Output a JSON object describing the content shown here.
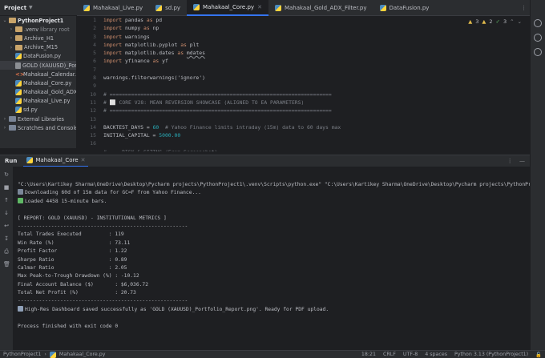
{
  "project_panel": {
    "title": "Project",
    "tree": [
      {
        "label": "PythonProject1",
        "type": "folder",
        "depth": 0,
        "expanded": true,
        "bold": true
      },
      {
        "label": ".venv",
        "suffix": "library root",
        "type": "folder",
        "depth": 1,
        "expanded": false
      },
      {
        "label": "Archive_H1",
        "type": "folder",
        "depth": 1,
        "expanded": false
      },
      {
        "label": "Archive_M15",
        "type": "folder",
        "depth": 1,
        "expanded": false
      },
      {
        "label": "DataFusion.py",
        "type": "py",
        "depth": 1
      },
      {
        "label": "GOLD (XAUUSD)_Port",
        "type": "file",
        "depth": 1,
        "selected": true
      },
      {
        "label": "Mahakaal_Calendar.h",
        "type": "html",
        "depth": 1
      },
      {
        "label": "Mahakaal_Core.py",
        "type": "py",
        "depth": 1
      },
      {
        "label": "Mahakaal_Gold_ADX_",
        "type": "py",
        "depth": 1
      },
      {
        "label": "Mahakaal_Live.py",
        "type": "py",
        "depth": 1
      },
      {
        "label": "sd.py",
        "type": "py",
        "depth": 1
      },
      {
        "label": "External Libraries",
        "type": "lib",
        "depth": 0,
        "expanded": false
      },
      {
        "label": "Scratches and Consoles",
        "type": "scratch",
        "depth": 0,
        "expanded": false
      }
    ]
  },
  "tabs": [
    {
      "label": "Mahakaal_Live.py",
      "active": false
    },
    {
      "label": "sd.py",
      "active": false
    },
    {
      "label": "Mahakaal_Core.py",
      "active": true
    },
    {
      "label": "Mahakaal_Gold_ADX_Filter.py",
      "active": false
    },
    {
      "label": "DataFusion.py",
      "active": false
    }
  ],
  "inspections": {
    "warnings": "3",
    "weak": "2",
    "typos": "3"
  },
  "editor": {
    "line_numbers": [
      "1",
      "2",
      "3",
      "4",
      "5",
      "6",
      "7",
      "8",
      "9",
      "10",
      "11",
      "12",
      "13",
      "14",
      "15",
      "16"
    ],
    "lines": [
      [
        {
          "t": "import",
          "c": "kw"
        },
        {
          "t": " pandas "
        },
        {
          "t": "as",
          "c": "kw"
        },
        {
          "t": " pd"
        }
      ],
      [
        {
          "t": "import",
          "c": "kw"
        },
        {
          "t": " numpy "
        },
        {
          "t": "as",
          "c": "kw"
        },
        {
          "t": " np"
        }
      ],
      [
        {
          "t": "import",
          "c": "kw"
        },
        {
          "t": " warnings"
        }
      ],
      [
        {
          "t": "import",
          "c": "kw"
        },
        {
          "t": " matplotlib.pyplot "
        },
        {
          "t": "as",
          "c": "kw"
        },
        {
          "t": " plt"
        }
      ],
      [
        {
          "t": "import",
          "c": "kw"
        },
        {
          "t": " matplotlib.dates "
        },
        {
          "t": "as",
          "c": "kw"
        },
        {
          "t": " "
        },
        {
          "t": "mdates",
          "c": "uline"
        }
      ],
      [
        {
          "t": "import",
          "c": "kw"
        },
        {
          "t": " yfinance "
        },
        {
          "t": "as",
          "c": "kw"
        },
        {
          "t": " yf"
        }
      ],
      [],
      [
        {
          "t": "warnings.filterwarnings('ignore')"
        }
      ],
      [],
      [
        {
          "t": "# ========================================================================",
          "c": "cm"
        }
      ],
      [
        {
          "t": "# ⬜ CORE V28: MEAN REVERSION SHOWCASE (ALIGNED TO EA PARAMETERS)",
          "c": "cm"
        }
      ],
      [
        {
          "t": "# ========================================================================",
          "c": "cm"
        }
      ],
      [],
      [
        {
          "t": "BACKTEST_DAYS = "
        },
        {
          "t": "60",
          "c": "num"
        },
        {
          "t": "  # Yahoo Finance limits intraday (15m) data to 60 days max",
          "c": "cm"
        }
      ],
      [
        {
          "t": "INITIAL_CAPITAL = "
        },
        {
          "t": "5000.00",
          "c": "num"
        }
      ],
      [],
      [
        {
          "t": "# --- RISK & SIZING (From Screenshot) ---",
          "c": "cm"
        }
      ]
    ]
  },
  "run_panel": {
    "title": "Run",
    "tab_label": "Mahakaal_Core",
    "output": [
      {
        "text": "\"C:\\Users\\Kartikey Sharma\\OneDrive\\Desktop\\Pycharm projects\\PythonProject1\\.venv\\Scripts\\python.exe\" \"C:\\Users\\Kartikey Sharma\\OneDrive\\Desktop\\Pycharm projects\\PythonProj"
      },
      {
        "icon": "download-icon",
        "text": "Downloading 60d of 15m data for GC=F from Yahoo Finance..."
      },
      {
        "icon": "check-icon",
        "text": "Loaded 4458 15-minute bars."
      },
      {
        "text": ""
      },
      {
        "text": "[ REPORT: GOLD (XAUUSD) - INSTITUTIONAL METRICS ]"
      },
      {
        "text": "--------------------------------------------------------"
      },
      {
        "text": "Total Trades Executed         : 119"
      },
      {
        "text": "Win Rate (%)                  : 73.11"
      },
      {
        "text": "Profit Factor                 : 1.22"
      },
      {
        "text": "Sharpe Ratio                  : 0.89"
      },
      {
        "text": "Calmar Ratio                  : 2.05"
      },
      {
        "text": "Max Peak-to-Trough Drawdown (%) : -10.12"
      },
      {
        "text": "Final Account Balance ($)       : $6,036.72"
      },
      {
        "text": "Total Net Profit (%)            : 20.73"
      },
      {
        "text": "--------------------------------------------------------"
      },
      {
        "icon": "chart-icon",
        "text": "High-Res Dashboard saved successfully as 'GOLD (XAUUSD)_Portfolio_Report.png'. Ready for PDF upload."
      },
      {
        "text": ""
      },
      {
        "text": "Process finished with exit code 0"
      }
    ]
  },
  "status_bar": {
    "breadcrumb_project": "PythonProject1",
    "breadcrumb_file": "Mahakaal_Core.py",
    "position": "18:21",
    "line_sep": "CRLF",
    "encoding": "UTF-8",
    "indent": "4 spaces",
    "interpreter": "Python 3.13 (PythonProject1)"
  }
}
